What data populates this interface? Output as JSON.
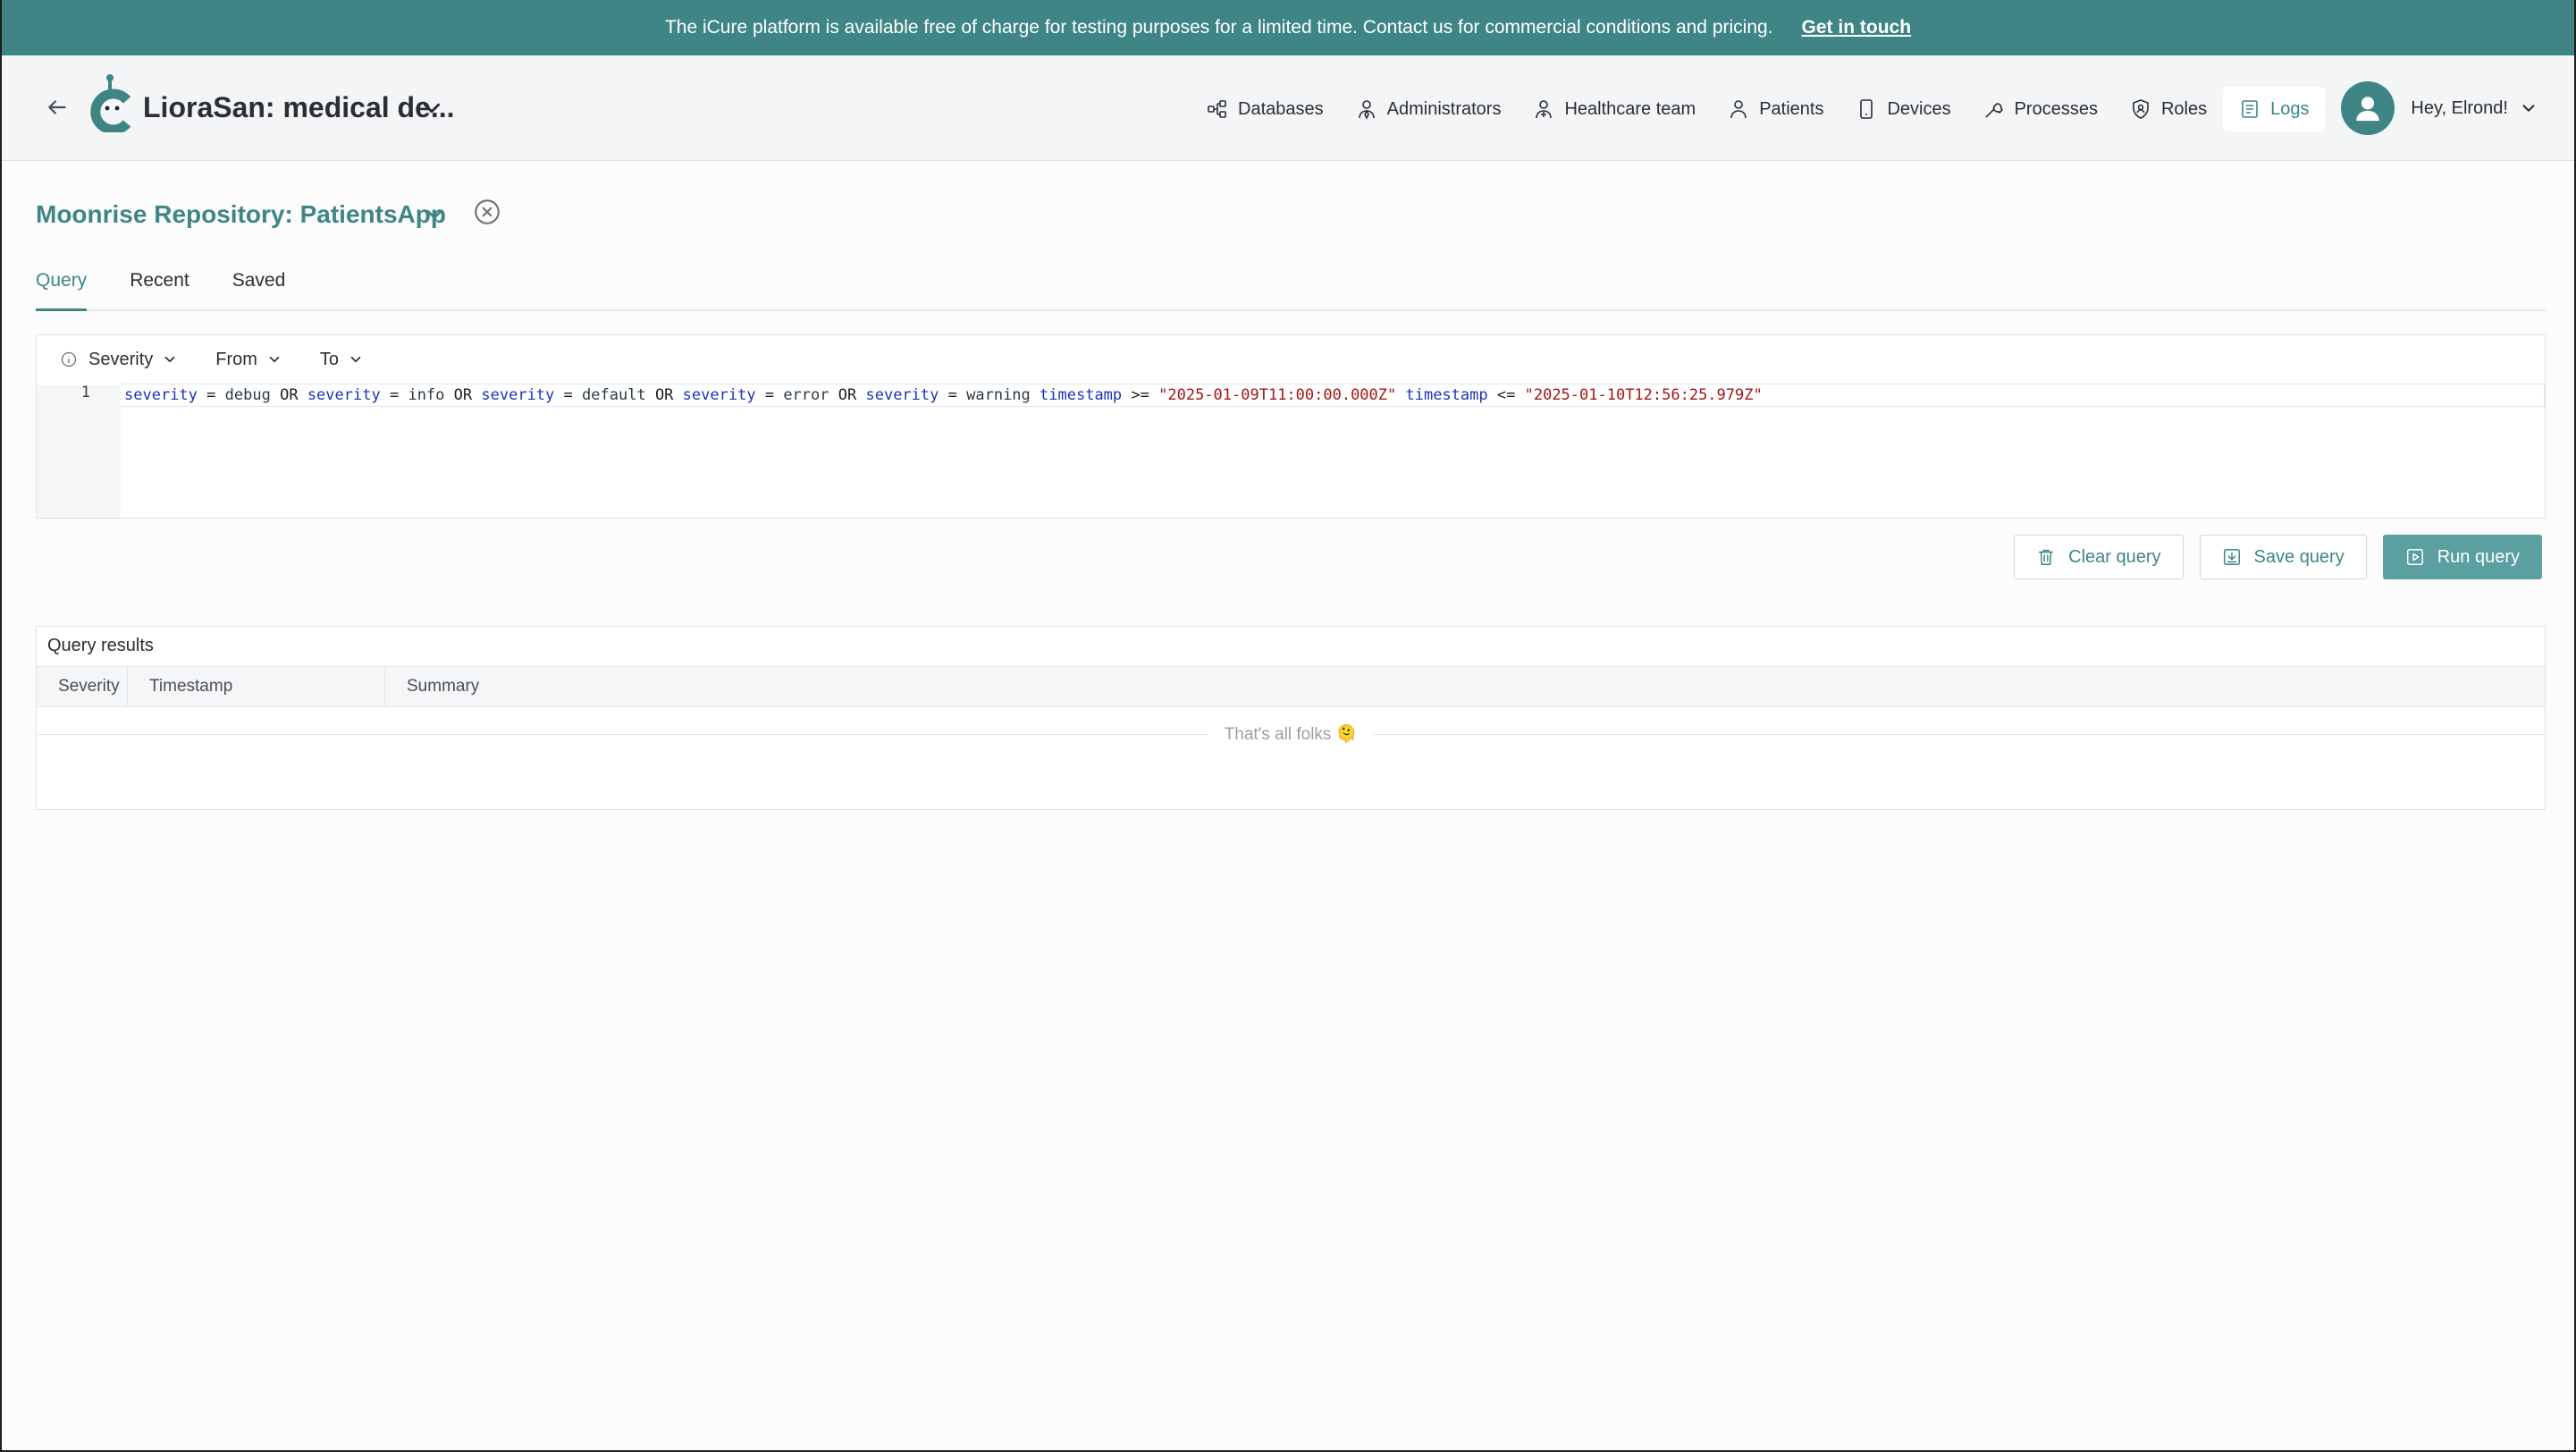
{
  "banner": {
    "text": "The iCure platform is available free of charge for testing purposes for a limited time. Contact us for commercial conditions and pricing.",
    "link": "Get in touch"
  },
  "header": {
    "app_title": "LioraSan: medical de...",
    "nav": [
      {
        "label": "Databases",
        "icon": "databases-icon"
      },
      {
        "label": "Administrators",
        "icon": "administrator-icon"
      },
      {
        "label": "Healthcare team",
        "icon": "healthcare-team-icon"
      },
      {
        "label": "Patients",
        "icon": "patient-icon"
      },
      {
        "label": "Devices",
        "icon": "device-icon"
      },
      {
        "label": "Processes",
        "icon": "process-icon"
      },
      {
        "label": "Roles",
        "icon": "roles-icon"
      },
      {
        "label": "Logs",
        "icon": "logs-icon",
        "active": true
      }
    ],
    "user_greeting": "Hey, Elrond!"
  },
  "repo": {
    "title": "Moonrise Repository: PatientsApp"
  },
  "tabs": [
    {
      "label": "Query",
      "active": true
    },
    {
      "label": "Recent"
    },
    {
      "label": "Saved"
    }
  ],
  "editor": {
    "filters": [
      "Severity",
      "From",
      "To"
    ],
    "line_number": "1",
    "query": "severity = debug OR severity = info OR severity = default OR severity = error OR severity = warning timestamp >= \"2025-01-09T11:00:00.000Z\" timestamp <= \"2025-01-10T12:56:25.979Z\""
  },
  "actions": {
    "clear": "Clear query",
    "save": "Save query",
    "run": "Run query"
  },
  "results": {
    "title": "Query results",
    "columns": [
      "Severity",
      "Timestamp",
      "Summary"
    ],
    "end_text": "That's all folks 🫠"
  },
  "colors": {
    "brand": "#3f8585",
    "primary_button": "#5aa0a0",
    "code_field": "#1a34b8",
    "code_string": "#a31515"
  }
}
